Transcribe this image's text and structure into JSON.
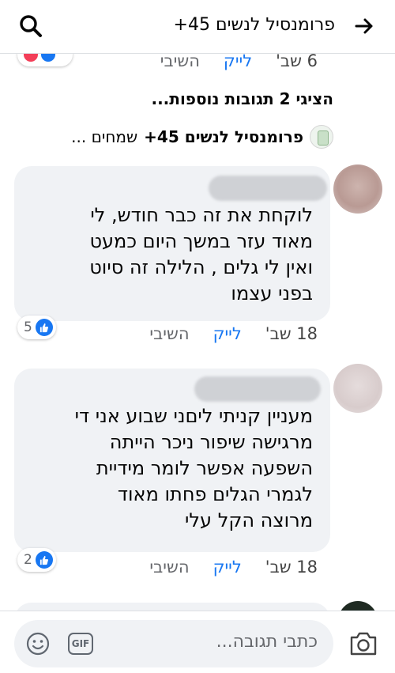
{
  "header": {
    "title": "פרומנסיל לנשים 45+",
    "back_icon": "arrow-right-icon",
    "search_icon": "search-icon"
  },
  "top_reply": {
    "time": "6 שב'",
    "like": "לייק",
    "reply": "השיבי"
  },
  "more_replies": "הציגי 2 תגובות נוספות...",
  "page_reply": {
    "name": "פרומנסיל לנשים 45+",
    "text": "שמחים ..."
  },
  "comments": [
    {
      "lines": [
        "לוקחת את זה כבר חודש, לי",
        "מאוד עזר במשך היום כמעט",
        "ואין לי גלים , הלילה זה סיוט",
        "בפני עצמו"
      ],
      "time": "18 שב'",
      "like": "לייק",
      "reply": "השיבי",
      "reactions": "5"
    },
    {
      "lines": [
        "מעניין קניתי ליםני שבוע אני די",
        "מרגישה שיפור ניכר הייתה",
        "השפעה אפשר לומר מידיית",
        "לגמרי הגלים פחתו מאוד",
        "מרוצה הקל עלי"
      ],
      "time": "18 שב'",
      "like": "לייק",
      "reply": "השיבי",
      "reactions": "2"
    }
  ],
  "composer": {
    "placeholder": "כתבי תגובה...",
    "gif_label": "GIF"
  },
  "colors": {
    "accent": "#1877f2",
    "bubble": "#f0f2f5",
    "secondary_text": "#65676b"
  }
}
